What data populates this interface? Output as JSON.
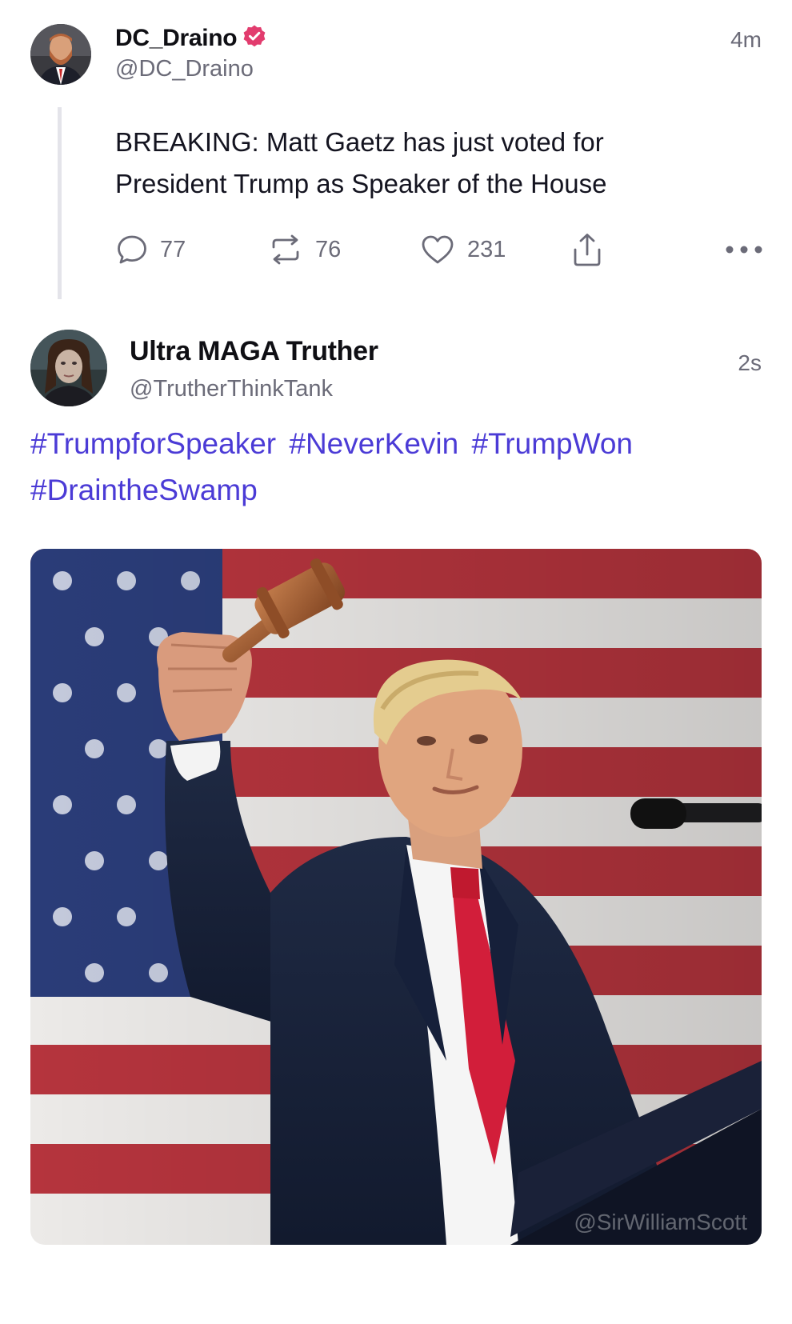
{
  "posts": [
    {
      "author": {
        "name": "DC_Draino",
        "handle": "@DC_Draino",
        "verified": true
      },
      "time": "4m",
      "text": "BREAKING: Matt Gaetz has just voted for President Trump as Speaker of the House",
      "counts": {
        "replies": "77",
        "reposts": "76",
        "likes": "231"
      }
    },
    {
      "author": {
        "name": "Ultra MAGA Truther",
        "handle": "@TrutherThinkTank"
      },
      "time": "2s",
      "hashtags": [
        "#TrumpforSpeaker",
        "#NeverKevin",
        "#TrumpWon",
        "#DraintheSwamp"
      ],
      "media": {
        "watermark": "@SirWilliamScott"
      }
    }
  ],
  "colors": {
    "hashtag": "#4b3bd6",
    "verified_badge": "#e23c6e",
    "muted_text": "#6b6b78",
    "thread_line": "#e4e4ea"
  },
  "icons": [
    "reply-icon",
    "repost-icon",
    "like-icon",
    "share-icon",
    "more-icon",
    "verified-badge-icon"
  ]
}
